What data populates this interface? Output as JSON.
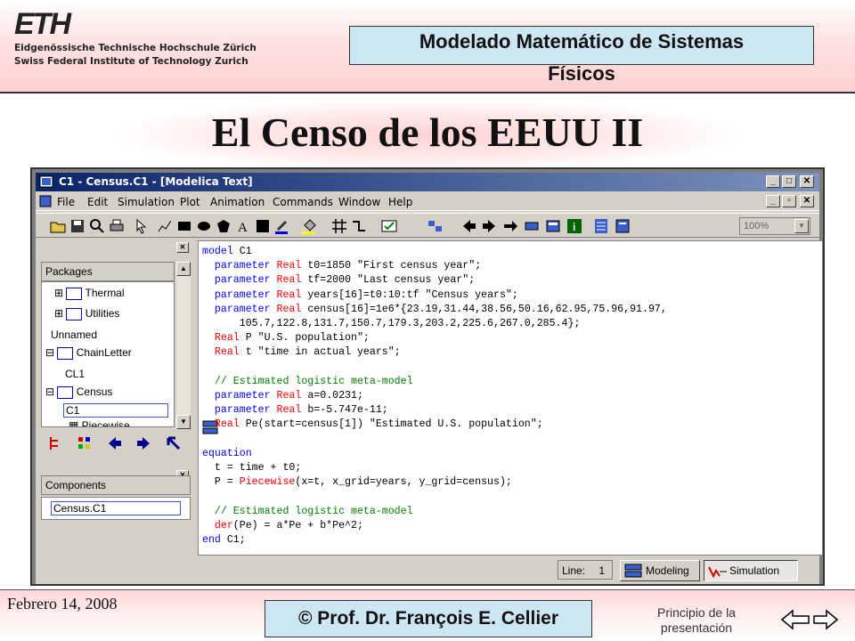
{
  "header": {
    "eth_logo": "ETH",
    "eth_line1": "Eidgenössische Technische Hochschule Zürich",
    "eth_line2": "Swiss Federal Institute of Technology Zurich",
    "course_title_1": "Modelado Matemático de Sistemas",
    "course_title_2": "Físicos"
  },
  "slide_title": "El Censo de los EEUU II",
  "window": {
    "title": "C1 - Census.C1 - [Modelica Text]",
    "menu": [
      "File",
      "Edit",
      "Simulation",
      "Plot",
      "Animation",
      "Commands",
      "Window",
      "Help"
    ],
    "zoom": "100%",
    "packages_label": "Packages",
    "tree": [
      "Thermal",
      "Utilities",
      "Unnamed",
      "ChainLetter",
      "CL1",
      "Census",
      "C1",
      "Piecewise"
    ],
    "components_label": "Components",
    "component_item": "Census.C1",
    "status_line_label": "Line:",
    "status_line_value": "1",
    "modeling_label": "Modeling",
    "simulation_label": "Simulation",
    "code": [
      "model C1",
      "  parameter Real t0=1850 \"First census year\";",
      "  parameter Real tf=2000 \"Last census year\";",
      "  parameter Real years[16]=t0:10:tf \"Census years\";",
      "  parameter Real census[16]=1e6*{23.19,31.44,38.56,50.16,62.95,75.96,91.97,",
      "      105.7,122.8,131.7,150.7,179.3,203.2,225.6,267.0,285.4};",
      "  Real P \"U.S. population\";",
      "  Real t \"time in actual years\";",
      "",
      "  // Estimated logistic meta-model",
      "  parameter Real a=0.0231;",
      "  parameter Real b=-5.747e-11;",
      "  Real Pe(start=census[1]) \"Estimated U.S. population\";",
      "",
      "equation",
      "  t = time + t0;",
      "  P = Piecewise(x=t, x_grid=years, y_grid=census);",
      "",
      "  // Estimated logistic meta-model",
      "  der(Pe) = a*Pe + b*Pe^2;",
      "end C1;"
    ]
  },
  "footer": {
    "date": "Febrero 14, 2008",
    "copyright": "© Prof. Dr. François E. Cellier",
    "home_link_1": "Principio de la",
    "home_link_2": "presentación"
  },
  "colors": {
    "title_box": "#cde6f3",
    "band": "#ffd0d0",
    "keyword": "#0000ff",
    "type": "#ff0000",
    "comment": "#008000"
  }
}
